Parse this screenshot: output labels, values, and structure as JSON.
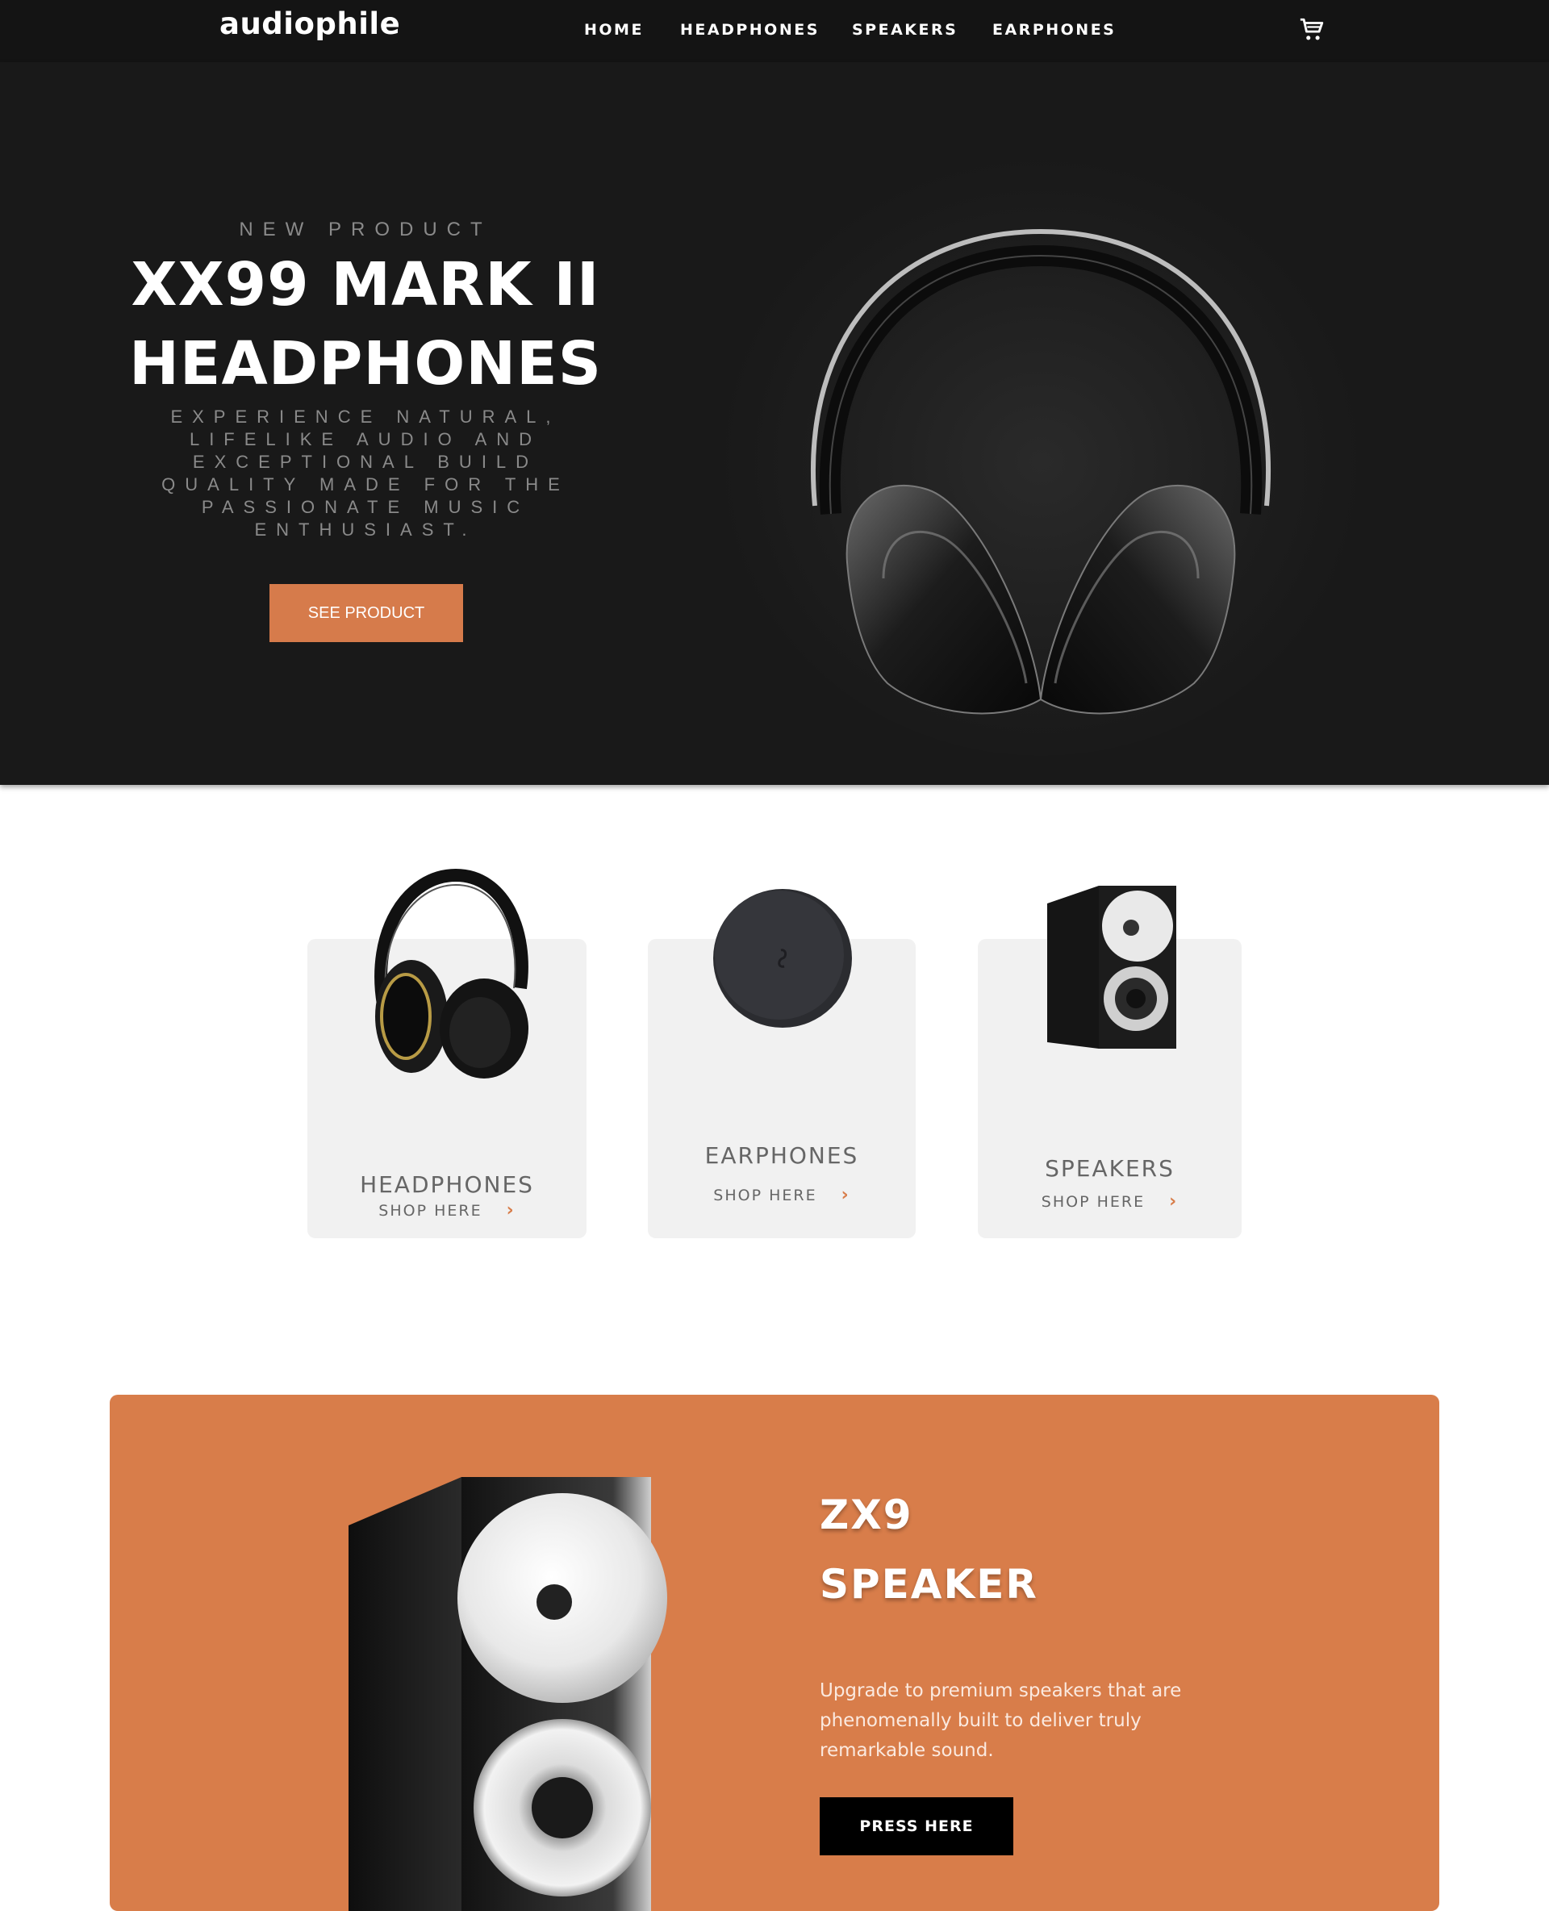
{
  "nav": {
    "logo": "audiophile",
    "links": [
      "HOME",
      "HEADPHONES",
      "SPEAKERS",
      "EARPHONES"
    ],
    "cart_icon": "cart-icon"
  },
  "hero": {
    "overline": "NEW PRODUCT",
    "title_line1": "XX99 MARK II",
    "title_line2": "HEADPHONES",
    "description": "EXPERIENCE NATURAL, LIFELIKE AUDIO AND EXCEPTIONAL BUILD QUALITY MADE FOR THE PASSIONATE MUSIC ENTHUSIAST.",
    "button": "SEE PRODUCT"
  },
  "categories": [
    {
      "title": "HEADPHONES",
      "shop": "SHOP HERE"
    },
    {
      "title": "EARPHONES",
      "shop": "SHOP HERE"
    },
    {
      "title": "SPEAKERS",
      "shop": "SHOP HERE"
    }
  ],
  "promo": {
    "title_line1": "ZX9",
    "title_line2": "SPEAKER",
    "description": "Upgrade to premium speakers that are phenomenally built to deliver truly remarkable sound.",
    "button": "PRESS HERE"
  },
  "colors": {
    "accent": "#d87d4a",
    "nav_bg": "#141414",
    "hero_bg": "#191919",
    "card_bg": "#f1f1f1"
  }
}
